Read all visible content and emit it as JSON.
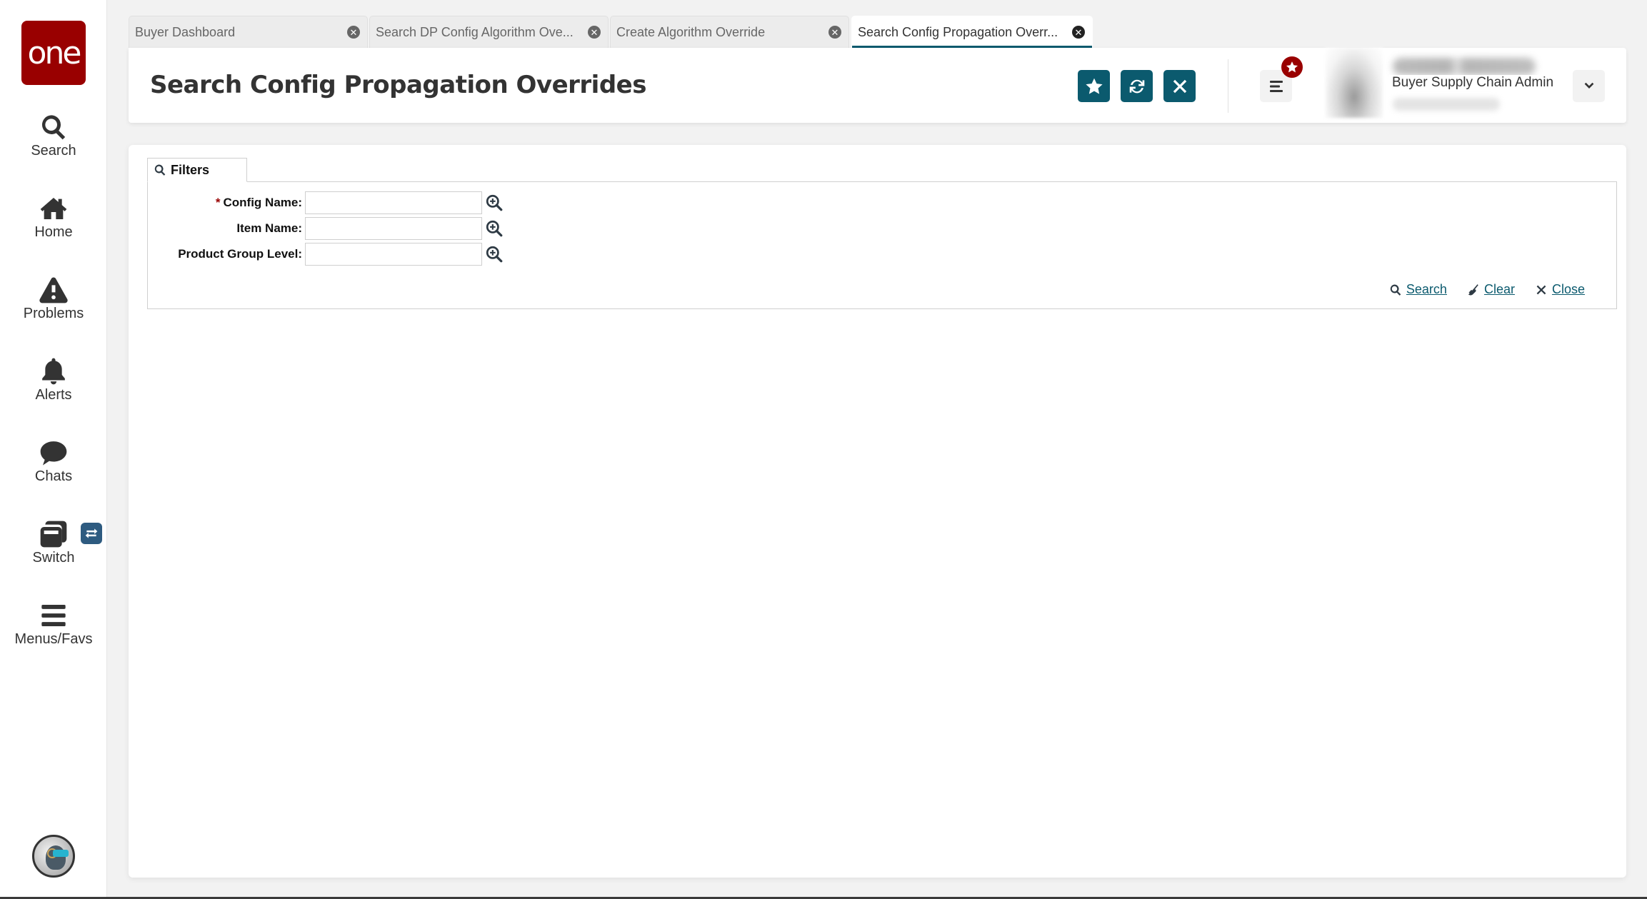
{
  "sidebar": {
    "logo_text": "one",
    "items": [
      {
        "label": "Search",
        "icon": "search-icon"
      },
      {
        "label": "Home",
        "icon": "home-icon"
      },
      {
        "label": "Problems",
        "icon": "warning-icon"
      },
      {
        "label": "Alerts",
        "icon": "bell-icon"
      },
      {
        "label": "Chats",
        "icon": "chat-bubble-icon"
      },
      {
        "label": "Switch",
        "icon": "switch-windows-icon"
      },
      {
        "label": "Menus/Favs",
        "icon": "menu-lines-icon"
      }
    ],
    "switch_badge_icon": "swap-arrows-icon",
    "assistant_icon": "ai-assistant-avatar"
  },
  "tabs": [
    {
      "label": "Buyer Dashboard",
      "active": false
    },
    {
      "label": "Search DP Config Algorithm Ove...",
      "active": false
    },
    {
      "label": "Create Algorithm Override",
      "active": false
    },
    {
      "label": "Search Config Propagation Overr...",
      "active": true
    }
  ],
  "header": {
    "title": "Search Config Propagation Overrides",
    "buttons": [
      {
        "name": "favorite",
        "icon": "star-icon"
      },
      {
        "name": "refresh",
        "icon": "refresh-icon"
      },
      {
        "name": "close",
        "icon": "close-icon"
      }
    ],
    "menu_icon": "menu-lines-icon",
    "menu_badge_icon": "star-icon",
    "user": {
      "role": "Buyer Supply Chain Admin"
    },
    "colors": {
      "accent": "#0b5a6e",
      "brand": "#990000"
    }
  },
  "filters": {
    "tab_label": "Filters",
    "fields": [
      {
        "label": "Config Name:",
        "required": true,
        "value": "",
        "placeholder": ""
      },
      {
        "label": "Item Name:",
        "required": false,
        "value": "",
        "placeholder": ""
      },
      {
        "label": "Product Group Level:",
        "required": false,
        "value": "",
        "placeholder": ""
      }
    ],
    "required_marker": "*",
    "actions": [
      {
        "label": "Search",
        "icon": "search-icon"
      },
      {
        "label": "Clear",
        "icon": "broom-icon"
      },
      {
        "label": "Close",
        "icon": "close-icon"
      }
    ]
  }
}
